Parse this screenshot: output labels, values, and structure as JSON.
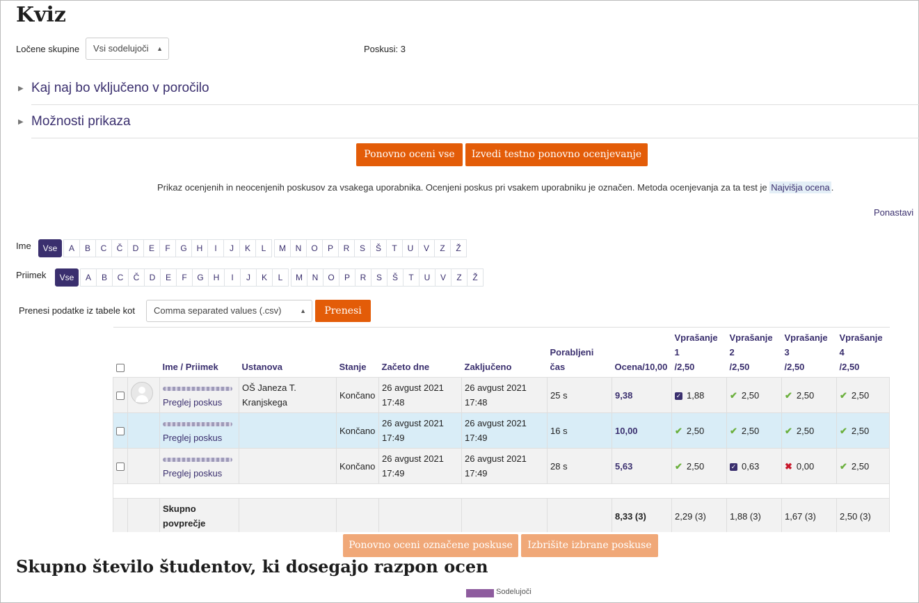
{
  "page": {
    "title": "Kviz"
  },
  "groups": {
    "label": "Ločene skupine",
    "selected": "Vsi sodelujoči",
    "attempts": "Poskusi: 3"
  },
  "sections": [
    {
      "label": "Kaj naj bo vključeno v poročilo"
    },
    {
      "label": "Možnosti prikaza"
    }
  ],
  "actions": {
    "regrade_all": "Ponovno oceni vse",
    "dry_run": "Izvedi testno ponovno ocenjevanje"
  },
  "info": {
    "text": "Prikaz ocenjenih in neocenjenih poskusov za vsakega uporabnika. Ocenjeni poskus pri vsakem uporabniku je označen. Metoda ocenjevanja za ta test je ",
    "method": "Najvišja ocena",
    "suffix": "."
  },
  "reset_link": "Ponastavi",
  "filters": {
    "first_label": "Ime",
    "last_label": "Priimek",
    "all": "Vse",
    "letters": [
      "A",
      "B",
      "C",
      "Č",
      "D",
      "E",
      "F",
      "G",
      "H",
      "I",
      "J",
      "K",
      "L",
      "M",
      "N",
      "O",
      "P",
      "R",
      "S",
      "Š",
      "T",
      "U",
      "V",
      "Z",
      "Ž"
    ]
  },
  "download": {
    "label": "Prenesi podatke iz tabele kot",
    "format": "Comma separated values (.csv)",
    "button": "Prenesi"
  },
  "table": {
    "headers": {
      "name": "Ime / Priimek",
      "institution": "Ustanova",
      "state": "Stanje",
      "started": "Začeto dne",
      "finished": "Zaključeno",
      "time_line1": "Porabljeni",
      "time_line2": "čas",
      "grade": "Ocena/10,00",
      "q1_l1": "Vprašanje",
      "q1_l2": "1",
      "q1_l3": "/2,50",
      "q2_l1": "Vprašanje",
      "q2_l2": "2",
      "q2_l3": "/2,50",
      "q3_l1": "Vprašanje",
      "q3_l2": "3",
      "q3_l3": "/2,50",
      "q4_l1": "Vprašanje",
      "q4_l2": "4",
      "q4_l3": "/2,50"
    },
    "rows": [
      {
        "review": "Preglej poskus",
        "inst1": "OŠ Janeza T.",
        "inst2": "Kranjskega",
        "state": "Končano",
        "start1": "26 avgust 2021",
        "start2": "17:48",
        "end1": "26 avgust 2021",
        "end2": "17:48",
        "time": "25 s",
        "grade": "9,38",
        "q1": "1,88",
        "q2": "2,50",
        "q3": "2,50",
        "q4": "2,50"
      },
      {
        "review": "Preglej poskus",
        "inst1": "",
        "inst2": "",
        "state": "Končano",
        "start1": "26 avgust 2021",
        "start2": "17:49",
        "end1": "26 avgust 2021",
        "end2": "17:49",
        "time": "16 s",
        "grade": "10,00",
        "q1": "2,50",
        "q2": "2,50",
        "q3": "2,50",
        "q4": "2,50"
      },
      {
        "review": "Preglej poskus",
        "inst1": "",
        "inst2": "",
        "state": "Končano",
        "start1": "26 avgust 2021",
        "start2": "17:49",
        "end1": "26 avgust 2021",
        "end2": "17:49",
        "time": "28 s",
        "grade": "5,63",
        "q1": "2,50",
        "q2": "0,63",
        "q3": "0,00",
        "q4": "2,50"
      }
    ],
    "avg": {
      "label1": "Skupno",
      "label2": "povprečje",
      "grade": "8,33 (3)",
      "q1": "2,29 (3)",
      "q2": "1,88 (3)",
      "q3": "1,67 (3)",
      "q4": "2,50 (3)"
    }
  },
  "bulk": {
    "regrade_selected": "Ponovno oceni označene poskuse",
    "delete_selected": "Izbrišite izbrane poskuse"
  },
  "chart": {
    "title": "Skupno število študentov, ki dosegajo razpon ocen",
    "legend": "Sodelujoči",
    "legend_color": "#8e5c9e"
  }
}
